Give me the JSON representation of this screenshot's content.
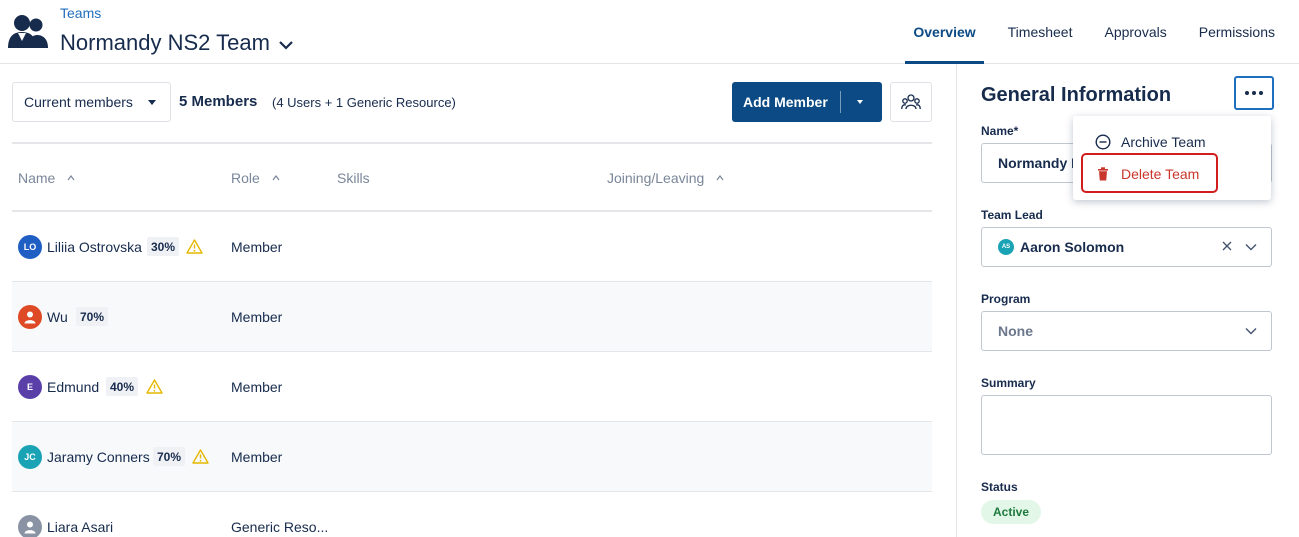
{
  "header": {
    "breadcrumb": "Teams",
    "title": "Normandy NS2 Team",
    "tabs": [
      {
        "label": "Overview",
        "active": true
      },
      {
        "label": "Timesheet",
        "active": false
      },
      {
        "label": "Approvals",
        "active": false
      },
      {
        "label": "Permissions",
        "active": false
      }
    ]
  },
  "toolbar": {
    "filter_label": "Current members",
    "member_count": "5 Members",
    "member_detail": "(4 Users + 1 Generic Resource)",
    "add_label": "Add Member"
  },
  "table": {
    "columns": [
      "Name",
      "Role",
      "Skills",
      "Joining/Leaving"
    ],
    "rows": [
      {
        "initials": "LO",
        "name": "Liliia Ostrovska",
        "allocation": "30%",
        "warning": true,
        "role": "Member",
        "avatar_color": "#1f5fc4"
      },
      {
        "initials": "",
        "name": "Wu",
        "allocation": "70%",
        "warning": false,
        "role": "Member",
        "avatar_color": "#de4a26"
      },
      {
        "initials": "E",
        "name": "Edmund",
        "allocation": "40%",
        "warning": true,
        "role": "Member",
        "avatar_color": "#5a3fa8"
      },
      {
        "initials": "JC",
        "name": "Jaramy Conners",
        "allocation": "70%",
        "warning": true,
        "role": "Member",
        "avatar_color": "#1aa3b5"
      },
      {
        "initials": "",
        "name": "Liara Asari",
        "allocation": "",
        "warning": false,
        "role": "Generic Reso...",
        "avatar_color": "#8993a4"
      }
    ]
  },
  "panel": {
    "title": "General Information",
    "name_label": "Name*",
    "name_value": "Normandy N",
    "lead_label": "Team Lead",
    "lead_initials": "AS",
    "lead_value": "Aaron Solomon",
    "program_label": "Program",
    "program_value": "None",
    "summary_label": "Summary",
    "status_label": "Status",
    "status_value": "Active"
  },
  "menu": {
    "archive_label": "Archive Team",
    "delete_label": "Delete Team"
  },
  "colors": {
    "brand": "#0b4a84",
    "link": "#1f6fbf",
    "danger": "#c9372c",
    "warning": "#e5b800",
    "success_bg": "#e3f7e9"
  }
}
